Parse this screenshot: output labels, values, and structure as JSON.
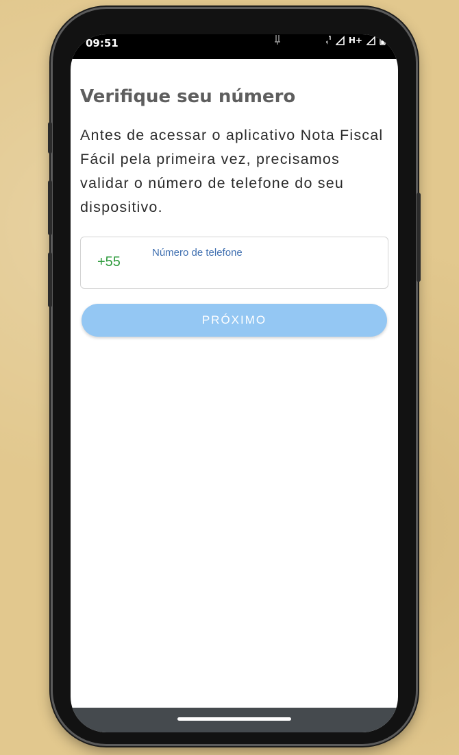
{
  "status_bar": {
    "time": "09:51",
    "network_label": "H+",
    "icons": [
      "notification-icon",
      "data-transfer-icon",
      "signal-icon",
      "signal-icon",
      "battery-icon"
    ]
  },
  "screen": {
    "title": "Verifique seu número",
    "description": "Antes de acessar o aplicativo Nota Fiscal Fácil pela primeira vez, precisamos validar o número de telefone do seu dispositivo.",
    "phone_field": {
      "prefix": "+55",
      "label": "Número de telefone",
      "value": ""
    },
    "next_button_label": "PRÓXIMO"
  },
  "colors": {
    "title": "#5e5e5e",
    "prefix": "#2e9b3c",
    "field_label": "#3f6fb0",
    "button_bg": "#94c7f3",
    "nav_bar": "#454a4e"
  }
}
